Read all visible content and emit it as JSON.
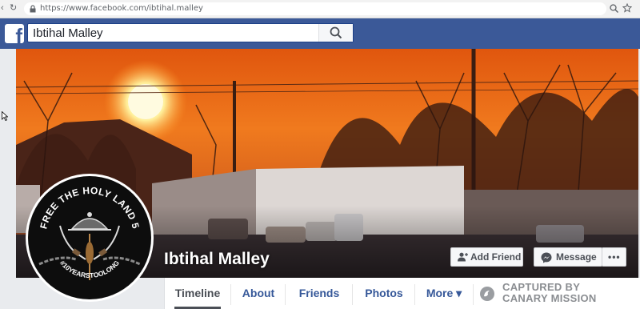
{
  "browser": {
    "url": "https://www.facebook.com/ibtihal.malley",
    "back_icon": "back-arrow-icon",
    "reload_icon": "reload-icon"
  },
  "header": {
    "logo_letter": "f",
    "search_value": "Ibtihal Malley",
    "brand_color": "#3b5998"
  },
  "profile": {
    "name": "Ibtihal Malley",
    "avatar_text_top": "FREE THE HOLY LAND 5",
    "avatar_text_bottom": "#10YEARSTOOLONG"
  },
  "actions": {
    "add_friend": "Add Friend",
    "message": "Message",
    "more": "•••"
  },
  "tabs": [
    {
      "label": "Timeline",
      "active": true
    },
    {
      "label": "About"
    },
    {
      "label": "Friends"
    },
    {
      "label": "Photos"
    },
    {
      "label": "More ▾"
    }
  ],
  "watermark": {
    "line1": "CAPTURED BY",
    "line2": "CANARY MISSION"
  }
}
